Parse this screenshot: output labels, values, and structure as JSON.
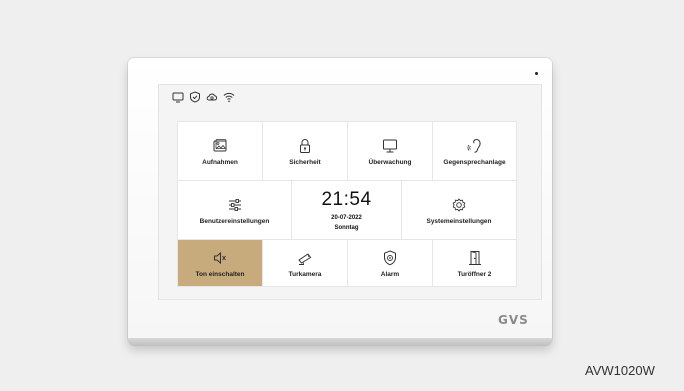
{
  "device": {
    "brand": "GVS",
    "model": "AVW1020W"
  },
  "status_icons": [
    "monitor-icon",
    "shield-check-icon",
    "cloud-sync-icon",
    "wifi-icon"
  ],
  "clock": {
    "time": "21:54",
    "date": "20-07-2022",
    "day": "Sonntag"
  },
  "tiles": [
    {
      "label": "Aufnahmen",
      "icon": "recordings-icon"
    },
    {
      "label": "Sicherheit",
      "icon": "lock-icon"
    },
    {
      "label": "Überwachung",
      "icon": "monitor-icon"
    },
    {
      "label": "Gegensprechanlage",
      "icon": "intercom-icon"
    },
    {
      "label": "Benutzereinstellungen",
      "icon": "sliders-icon"
    },
    {
      "label": "Systemeinstellungen",
      "icon": "gear-icon"
    },
    {
      "label": "Ton einschalten",
      "icon": "speaker-icon",
      "active": true
    },
    {
      "label": "Turkamera",
      "icon": "camera-icon"
    },
    {
      "label": "Alarm",
      "icon": "alarm-shield-icon"
    },
    {
      "label": "Turöffner 2",
      "icon": "door-icon"
    }
  ],
  "colors": {
    "active_tile": "#c8ab7c",
    "tile": "#ffffff",
    "screen": "#f4f4f4"
  }
}
